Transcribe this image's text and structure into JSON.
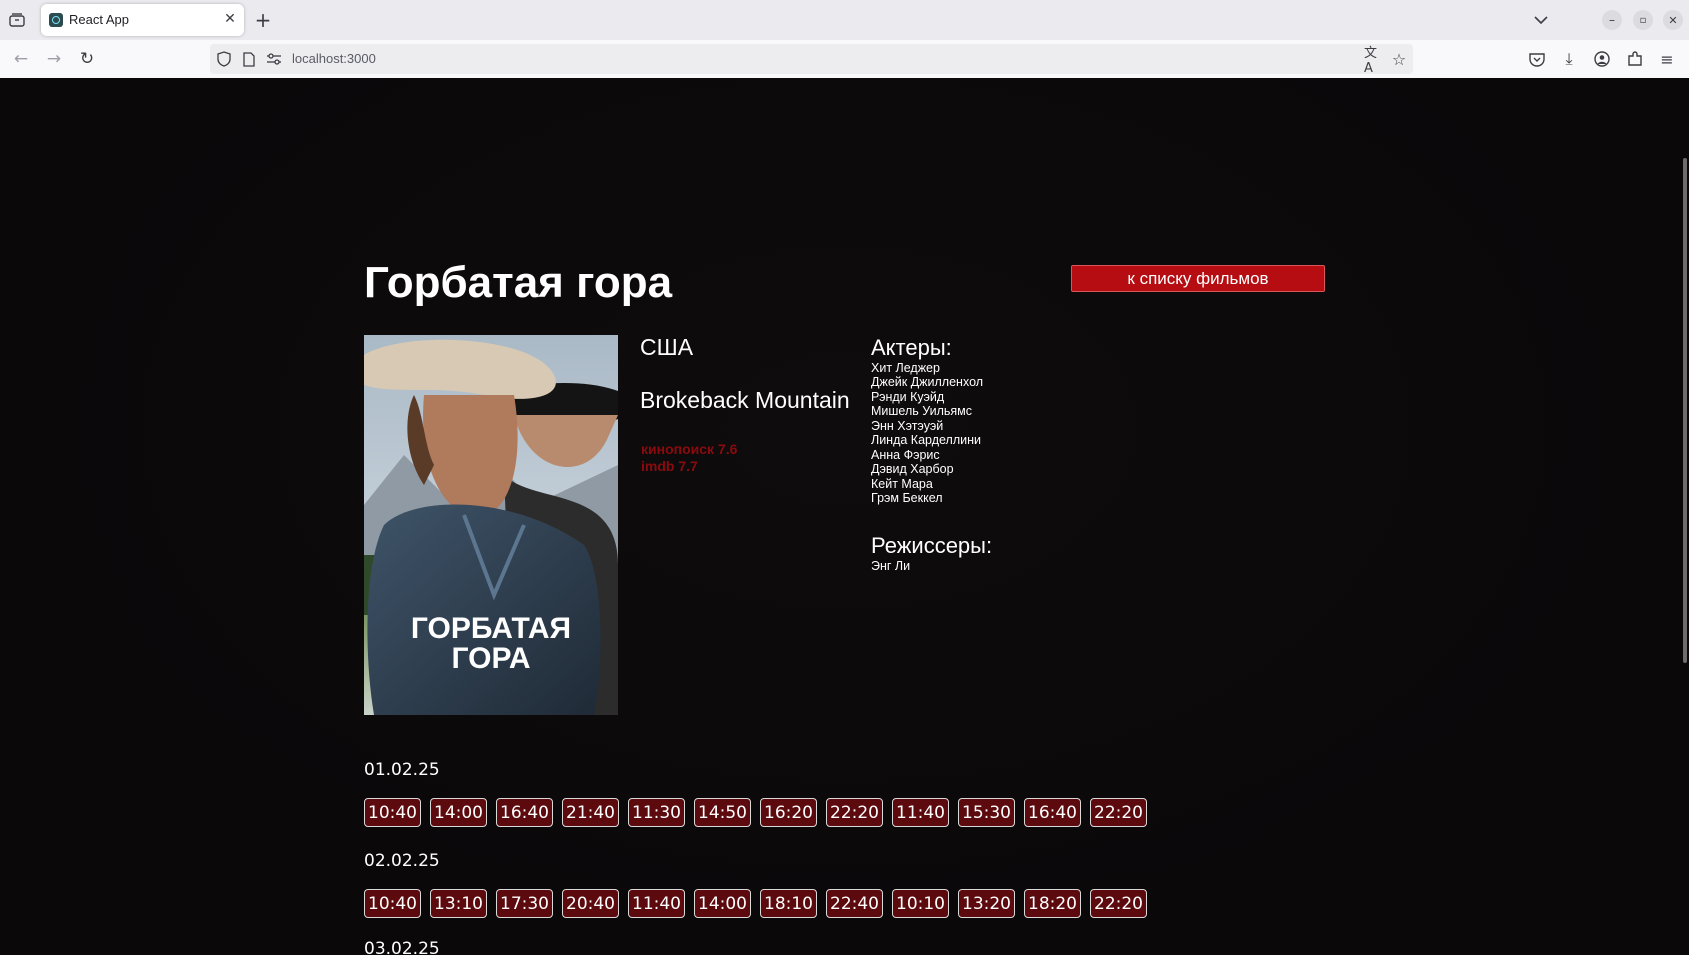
{
  "browser": {
    "tab_title": "React App",
    "url": "localhost:3000"
  },
  "movie": {
    "title": "Горбатая гора",
    "back_button": "к списку фильмов",
    "country": "США",
    "original_title": "Brokeback Mountain",
    "ratings": [
      "кинопоиск 7.6",
      "imdb 7.7"
    ],
    "poster_text_line1": "ГОРБАТАЯ",
    "poster_text_line2": "ГОРА",
    "actors_heading": "Актеры:",
    "actors": [
      "Хит Леджер",
      "Джейк Джилленхол",
      "Рэнди Куэйд",
      "Мишель Уильямс",
      "Энн Хэтэуэй",
      "Линда Карделлини",
      "Анна Фэрис",
      "Дэвид Харбор",
      "Кейт Мара",
      "Грэм Беккел"
    ],
    "directors_heading": "Режиссеры:",
    "directors": [
      "Энг Ли"
    ]
  },
  "schedule": [
    {
      "date": "01.02.25",
      "times": [
        "10:40",
        "14:00",
        "16:40",
        "21:40",
        "11:30",
        "14:50",
        "16:20",
        "22:20",
        "11:40",
        "15:30",
        "16:40",
        "22:20"
      ]
    },
    {
      "date": "02.02.25",
      "times": [
        "10:40",
        "13:10",
        "17:30",
        "20:40",
        "11:40",
        "14:00",
        "18:10",
        "22:40",
        "10:10",
        "13:20",
        "18:20",
        "22:20"
      ]
    },
    {
      "date": "03.02.25",
      "times": []
    }
  ],
  "colors": {
    "accent_red": "#b50d12",
    "time_button_bg": "#5c0a0e",
    "rating_red": "#8b0a0e"
  }
}
